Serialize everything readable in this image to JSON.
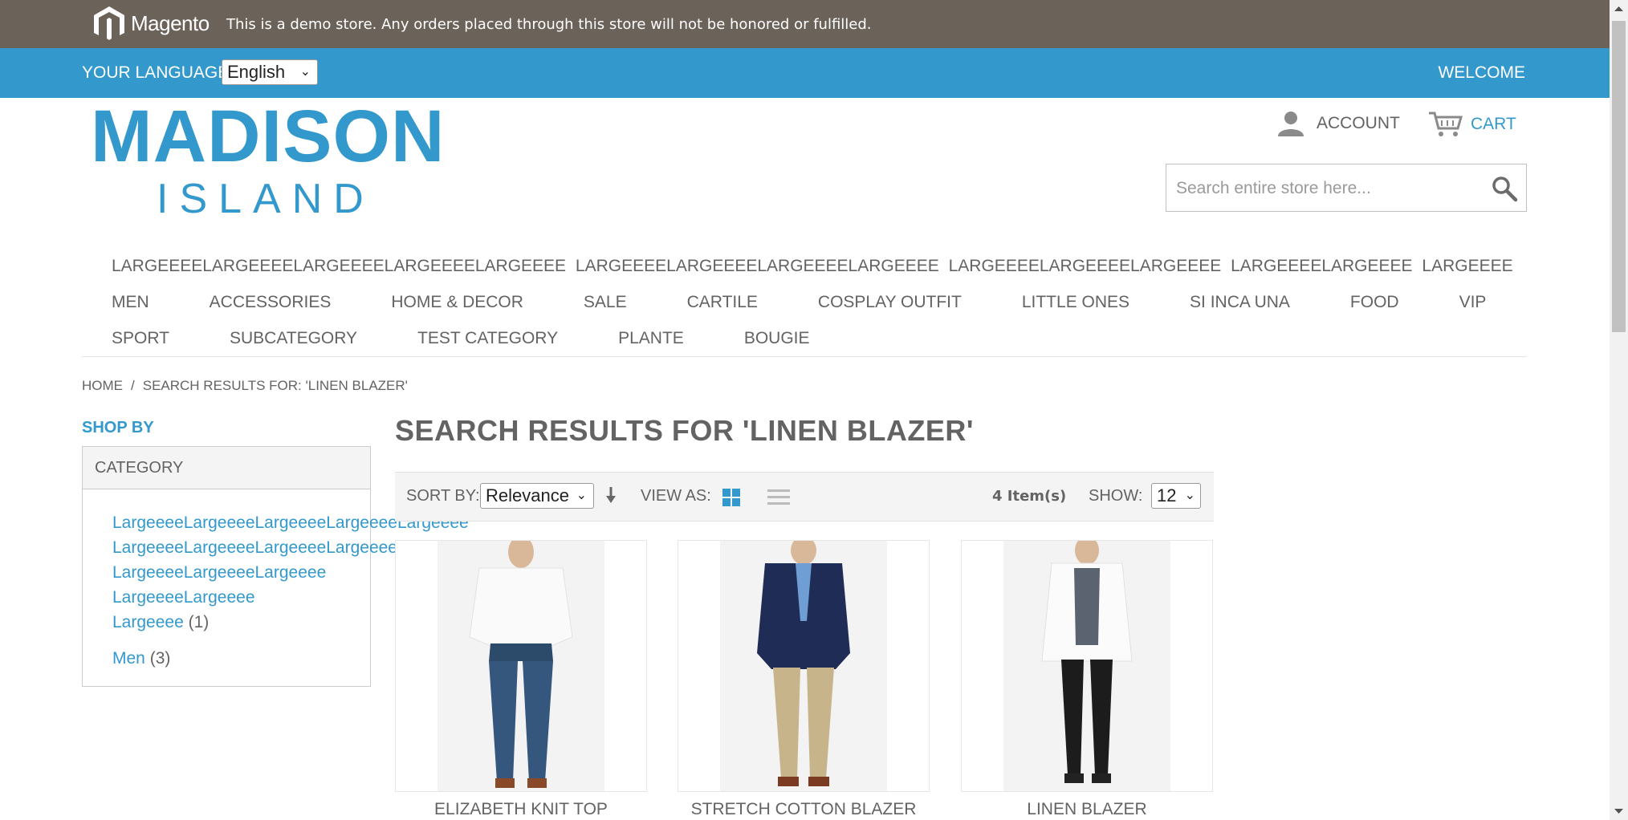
{
  "demo_notice": {
    "brand": "Magento",
    "text": "This is a demo store. Any orders placed through this store will not be honored or fulfilled."
  },
  "language_bar": {
    "label": "YOUR LANGUAGE:",
    "selected": "English",
    "welcome": "WELCOME"
  },
  "header": {
    "logo_main": "MADISON",
    "logo_sub": "ISLAND",
    "account": "ACCOUNT",
    "cart": "CART",
    "search_placeholder": "Search entire store here..."
  },
  "nav": {
    "long_items": [
      "LARGEEEELARGEEEELARGEEEELARGEEEELARGEEEE",
      "LARGEEEELARGEEEELARGEEEELARGEEEE",
      "LARGEEEELARGEEEELARGEEEE",
      "LARGEEEELARGEEEE",
      "LARGEEEE"
    ],
    "row1": [
      "MEN",
      "ACCESSORIES",
      "HOME & DECOR",
      "SALE",
      "CARTILE",
      "COSPLAY OUTFIT",
      "LITTLE ONES",
      "SI INCA UNA",
      "FOOD",
      "VIP"
    ],
    "row2": [
      "SPORT",
      "SUBCATEGORY",
      "TEST CATEGORY",
      "PLANTE",
      "BOUGIE"
    ]
  },
  "breadcrumbs": {
    "home": "HOME",
    "separator": "/",
    "current": "SEARCH RESULTS FOR: 'LINEN BLAZER'"
  },
  "sidebar": {
    "shop_by": "SHOP BY",
    "category_heading": "CATEGORY",
    "items": [
      {
        "label": "LargeeeeLargeeeeLargeeeeLargeeeeLargeeee",
        "count": ""
      },
      {
        "label": "LargeeeeLargeeeeLargeeeeLargeeee",
        "count": ""
      },
      {
        "label": "LargeeeeLargeeeeLargeeee",
        "count": ""
      },
      {
        "label": "LargeeeeLargeeee",
        "count": ""
      },
      {
        "label": "Largeeee",
        "count": "(1)"
      },
      {
        "label": "Men",
        "count": "(3)"
      }
    ]
  },
  "main": {
    "title": "SEARCH RESULTS FOR 'LINEN BLAZER'",
    "toolbar": {
      "sort_label": "SORT BY:",
      "sort_selected": "Relevance",
      "view_label": "VIEW AS:",
      "count": "4 Item(s)",
      "show_label": "SHOW:",
      "show_selected": "12"
    },
    "products": [
      {
        "name": "ELIZABETH KNIT TOP"
      },
      {
        "name": "STRETCH COTTON BLAZER"
      },
      {
        "name": "LINEN BLAZER"
      }
    ]
  },
  "colors": {
    "accent": "#3399cc",
    "demo_bar": "#6b6259",
    "text": "#636363"
  }
}
